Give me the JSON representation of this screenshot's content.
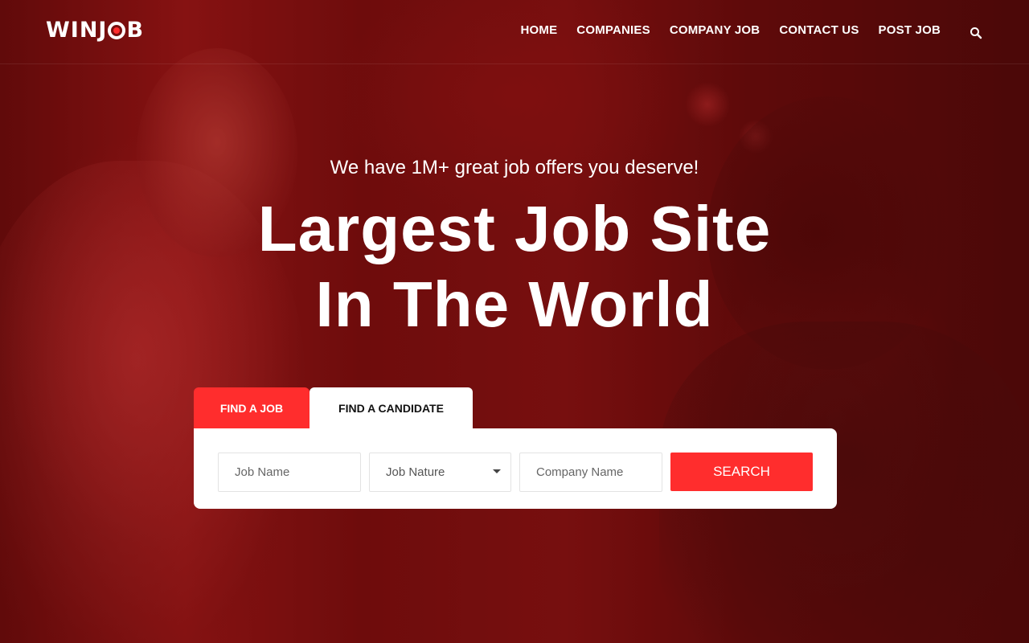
{
  "brand": {
    "logo_prefix": "WINJ",
    "logo_suffix": "B",
    "accent_color": "#ff2d2d"
  },
  "nav": {
    "items": [
      "HOME",
      "COMPANIES",
      "COMPANY JOB",
      "CONTACT US",
      "POST JOB"
    ],
    "search_icon": "search-icon"
  },
  "hero": {
    "tagline": "We have 1M+ great job offers you deserve!",
    "headline_line1": "Largest Job Site",
    "headline_line2": "In The World"
  },
  "search": {
    "tabs": [
      "FIND A JOB",
      "FIND A CANDIDATE"
    ],
    "job_name_placeholder": "Job Name",
    "job_nature_value": "Job Nature",
    "company_placeholder": "Company Name",
    "submit_label": "SEARCH"
  }
}
